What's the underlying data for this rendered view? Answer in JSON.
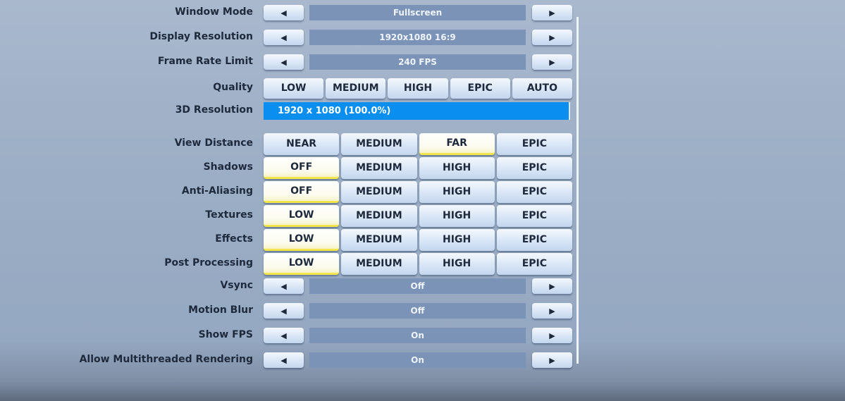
{
  "settings": [
    {
      "label": "Window Mode",
      "type": "arrow",
      "value": "Fullscreen"
    },
    {
      "label": "Display Resolution",
      "type": "arrow",
      "value": "1920x1080 16:9"
    },
    {
      "label": "Frame Rate Limit",
      "type": "arrow",
      "value": "240 FPS"
    },
    {
      "label": "Quality",
      "type": "options",
      "options": [
        "LOW",
        "MEDIUM",
        "HIGH",
        "EPIC",
        "AUTO"
      ],
      "selected": -1
    },
    {
      "label": "3D Resolution",
      "type": "bar",
      "value": "1920 x 1080 (100.0%)"
    },
    {
      "label": "View Distance",
      "type": "options",
      "options": [
        "NEAR",
        "MEDIUM",
        "FAR",
        "EPIC"
      ],
      "selected": 2
    },
    {
      "label": "Shadows",
      "type": "options",
      "options": [
        "OFF",
        "MEDIUM",
        "HIGH",
        "EPIC"
      ],
      "selected": 0
    },
    {
      "label": "Anti-Aliasing",
      "type": "options",
      "options": [
        "OFF",
        "MEDIUM",
        "HIGH",
        "EPIC"
      ],
      "selected": 0
    },
    {
      "label": "Textures",
      "type": "options",
      "options": [
        "LOW",
        "MEDIUM",
        "HIGH",
        "EPIC"
      ],
      "selected": 0
    },
    {
      "label": "Effects",
      "type": "options",
      "options": [
        "LOW",
        "MEDIUM",
        "HIGH",
        "EPIC"
      ],
      "selected": 0
    },
    {
      "label": "Post Processing",
      "type": "options",
      "options": [
        "LOW",
        "MEDIUM",
        "HIGH",
        "EPIC"
      ],
      "selected": 0
    },
    {
      "label": "Vsync",
      "type": "arrow",
      "value": "Off"
    },
    {
      "label": "Motion Blur",
      "type": "arrow",
      "value": "Off"
    },
    {
      "label": "Show FPS",
      "type": "arrow",
      "value": "On"
    },
    {
      "label": "Allow Multithreaded Rendering",
      "type": "arrow",
      "value": "On"
    }
  ],
  "icons": {
    "prev": "◀",
    "next": "▶"
  },
  "colors": {
    "resolution_bar": "#0a8ef0",
    "selected_underline": "#f2e64a"
  }
}
